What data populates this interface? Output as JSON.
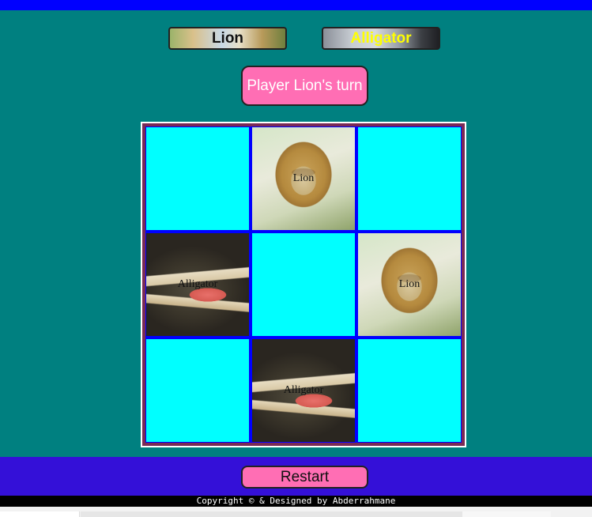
{
  "players": {
    "player1": "Lion",
    "player2": "Alligator"
  },
  "turn_text": "Player Lion's turn",
  "board": {
    "cells": [
      {
        "mark": "",
        "picture": "empty"
      },
      {
        "mark": "Lion",
        "picture": "lion-photo"
      },
      {
        "mark": "",
        "picture": "empty"
      },
      {
        "mark": "Alligator",
        "picture": "alligator-photo"
      },
      {
        "mark": "",
        "picture": "empty"
      },
      {
        "mark": "Lion",
        "picture": "lion-photo"
      },
      {
        "mark": "",
        "picture": "empty"
      },
      {
        "mark": "Alligator",
        "picture": "alligator-photo"
      },
      {
        "mark": "",
        "picture": "empty"
      }
    ]
  },
  "restart_label": "Restart",
  "copyright": "Copyright © & Designed by Abderrahmane",
  "colors": {
    "background": "#008080",
    "top_bar": "#0000ff",
    "empty_cell": "#00ffff",
    "grid_lines": "#0000ff",
    "board_border": "#7a2a55",
    "button_pink": "#ff6eb4",
    "footer_bar": "#3410d8",
    "player2_text": "#ffff00"
  }
}
